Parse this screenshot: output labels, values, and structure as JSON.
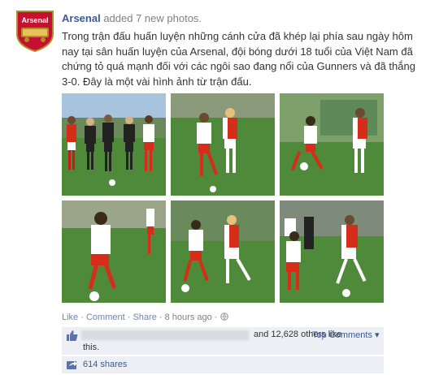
{
  "post": {
    "page_name": "Arsenal",
    "action_text": "added 7 new photos.",
    "message": "Trong trận đấu huấn luyện những cánh cửa đã khép lại phía sau ngày hôm nay tại sân huấn luyện của Arsenal, đội bóng dưới 18 tuổi của Việt Nam đã chứng tỏ quá mạnh đối với các ngôi sao đang nổi của Gunners và đã thắng 3-0. Đây là một vài hình ảnh từ trận đấu.",
    "logo_text": "Arsenal"
  },
  "actions": {
    "like": "Like",
    "sep1": "·",
    "comment": "Comment",
    "sep2": "·",
    "share": "Share",
    "sep3": "·",
    "time": "8 hours ago",
    "sep4": "·"
  },
  "likes": {
    "text": "and 12,628 others like",
    "continuation": "this.",
    "top_comments": "Top Comments ▾"
  },
  "shares": {
    "text": "614 shares"
  },
  "colors": {
    "link_blue": "#3b5998",
    "arsenal_red": "#e4232b",
    "vietnam_red": "#d62c1a",
    "pitch_green": "#4e8a3a"
  }
}
